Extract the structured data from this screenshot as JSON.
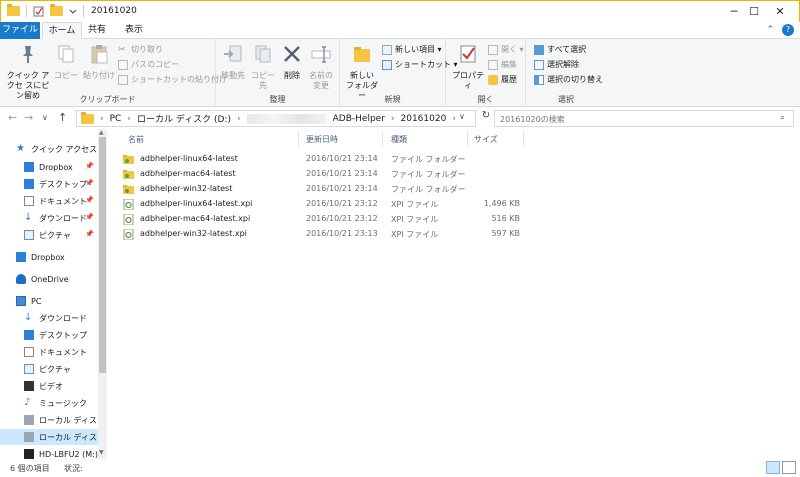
{
  "window": {
    "title": "20161020",
    "controls": {
      "minimize": "─",
      "maximize": "☐",
      "close": "✕"
    }
  },
  "tabs": {
    "file": "ファイル",
    "home": "ホーム",
    "share": "共有",
    "view": "表示"
  },
  "ribbon": {
    "clipboard": {
      "label": "クリップボード",
      "pin_quick": "クイック アクセ スにピン留め",
      "copy": "コピー",
      "paste": "貼り付け",
      "cut": "切り取り",
      "copy_path": "パスのコピー",
      "paste_shortcut": "ショートカットの貼り付け"
    },
    "organize": {
      "label": "整理",
      "move_to": "移動先",
      "copy_to": "コピー先",
      "delete": "削除",
      "rename_1": "名前の",
      "rename_2": "変更"
    },
    "new": {
      "label": "新規",
      "new_folder_1": "新しい",
      "new_folder_2": "フォルダー",
      "new_item": "新しい項目 ▾",
      "shortcut": "ショートカット ▾"
    },
    "open": {
      "label": "開く",
      "properties": "プロパティ",
      "open": "開く ▾",
      "edit": "編集",
      "history": "履歴"
    },
    "select": {
      "label": "選択",
      "select_all": "すべて選択",
      "select_none": "選択解除",
      "invert": "選択の切り替え"
    }
  },
  "address": {
    "crumbs": [
      "PC",
      "ローカル ディスク (D:)",
      "ADB-Helper",
      "20161020"
    ],
    "search_placeholder": "20161020の検索"
  },
  "nav": {
    "quick_access": "クイック アクセス",
    "items": [
      {
        "label": "Dropbox"
      },
      {
        "label": "デスクトップ"
      },
      {
        "label": "ドキュメント"
      },
      {
        "label": "ダウンロード"
      },
      {
        "label": "ピクチャ"
      },
      {
        "label": "Dropbox"
      },
      {
        "label": "OneDrive"
      },
      {
        "label": "PC"
      },
      {
        "label": "ダウンロード"
      },
      {
        "label": "デスクトップ"
      },
      {
        "label": "ドキュメント"
      },
      {
        "label": "ピクチャ"
      },
      {
        "label": "ビデオ"
      },
      {
        "label": "ミュージック"
      },
      {
        "label": "ローカル ディスク (C"
      },
      {
        "label": "ローカル ディスク (D"
      },
      {
        "label": "HD-LBFU2 (M:)"
      }
    ]
  },
  "columns": {
    "name": "名前",
    "date": "更新日時",
    "type": "種類",
    "size": "サイズ"
  },
  "files": [
    {
      "name": "adbhelper-linux64-latest",
      "date": "2016/10/21 23:14",
      "type": "ファイル フォルダー",
      "size": ""
    },
    {
      "name": "adbhelper-mac64-latest",
      "date": "2016/10/21 23:14",
      "type": "ファイル フォルダー",
      "size": ""
    },
    {
      "name": "adbhelper-win32-latest",
      "date": "2016/10/21 23:14",
      "type": "ファイル フォルダー",
      "size": ""
    },
    {
      "name": "adbhelper-linux64-latest.xpi",
      "date": "2016/10/21 23:12",
      "type": "XPI ファイル",
      "size": "1,496 KB"
    },
    {
      "name": "adbhelper-mac64-latest.xpi",
      "date": "2016/10/21 23:12",
      "type": "XPI ファイル",
      "size": "516 KB"
    },
    {
      "name": "adbhelper-win32-latest.xpi",
      "date": "2016/10/21 23:13",
      "type": "XPI ファイル",
      "size": "597 KB"
    }
  ],
  "status": {
    "count": "6 個の項目",
    "state": "状況:"
  },
  "colors": {
    "accent": "#1979ca",
    "folder": "#f5c440",
    "selection": "#cce8ff"
  }
}
